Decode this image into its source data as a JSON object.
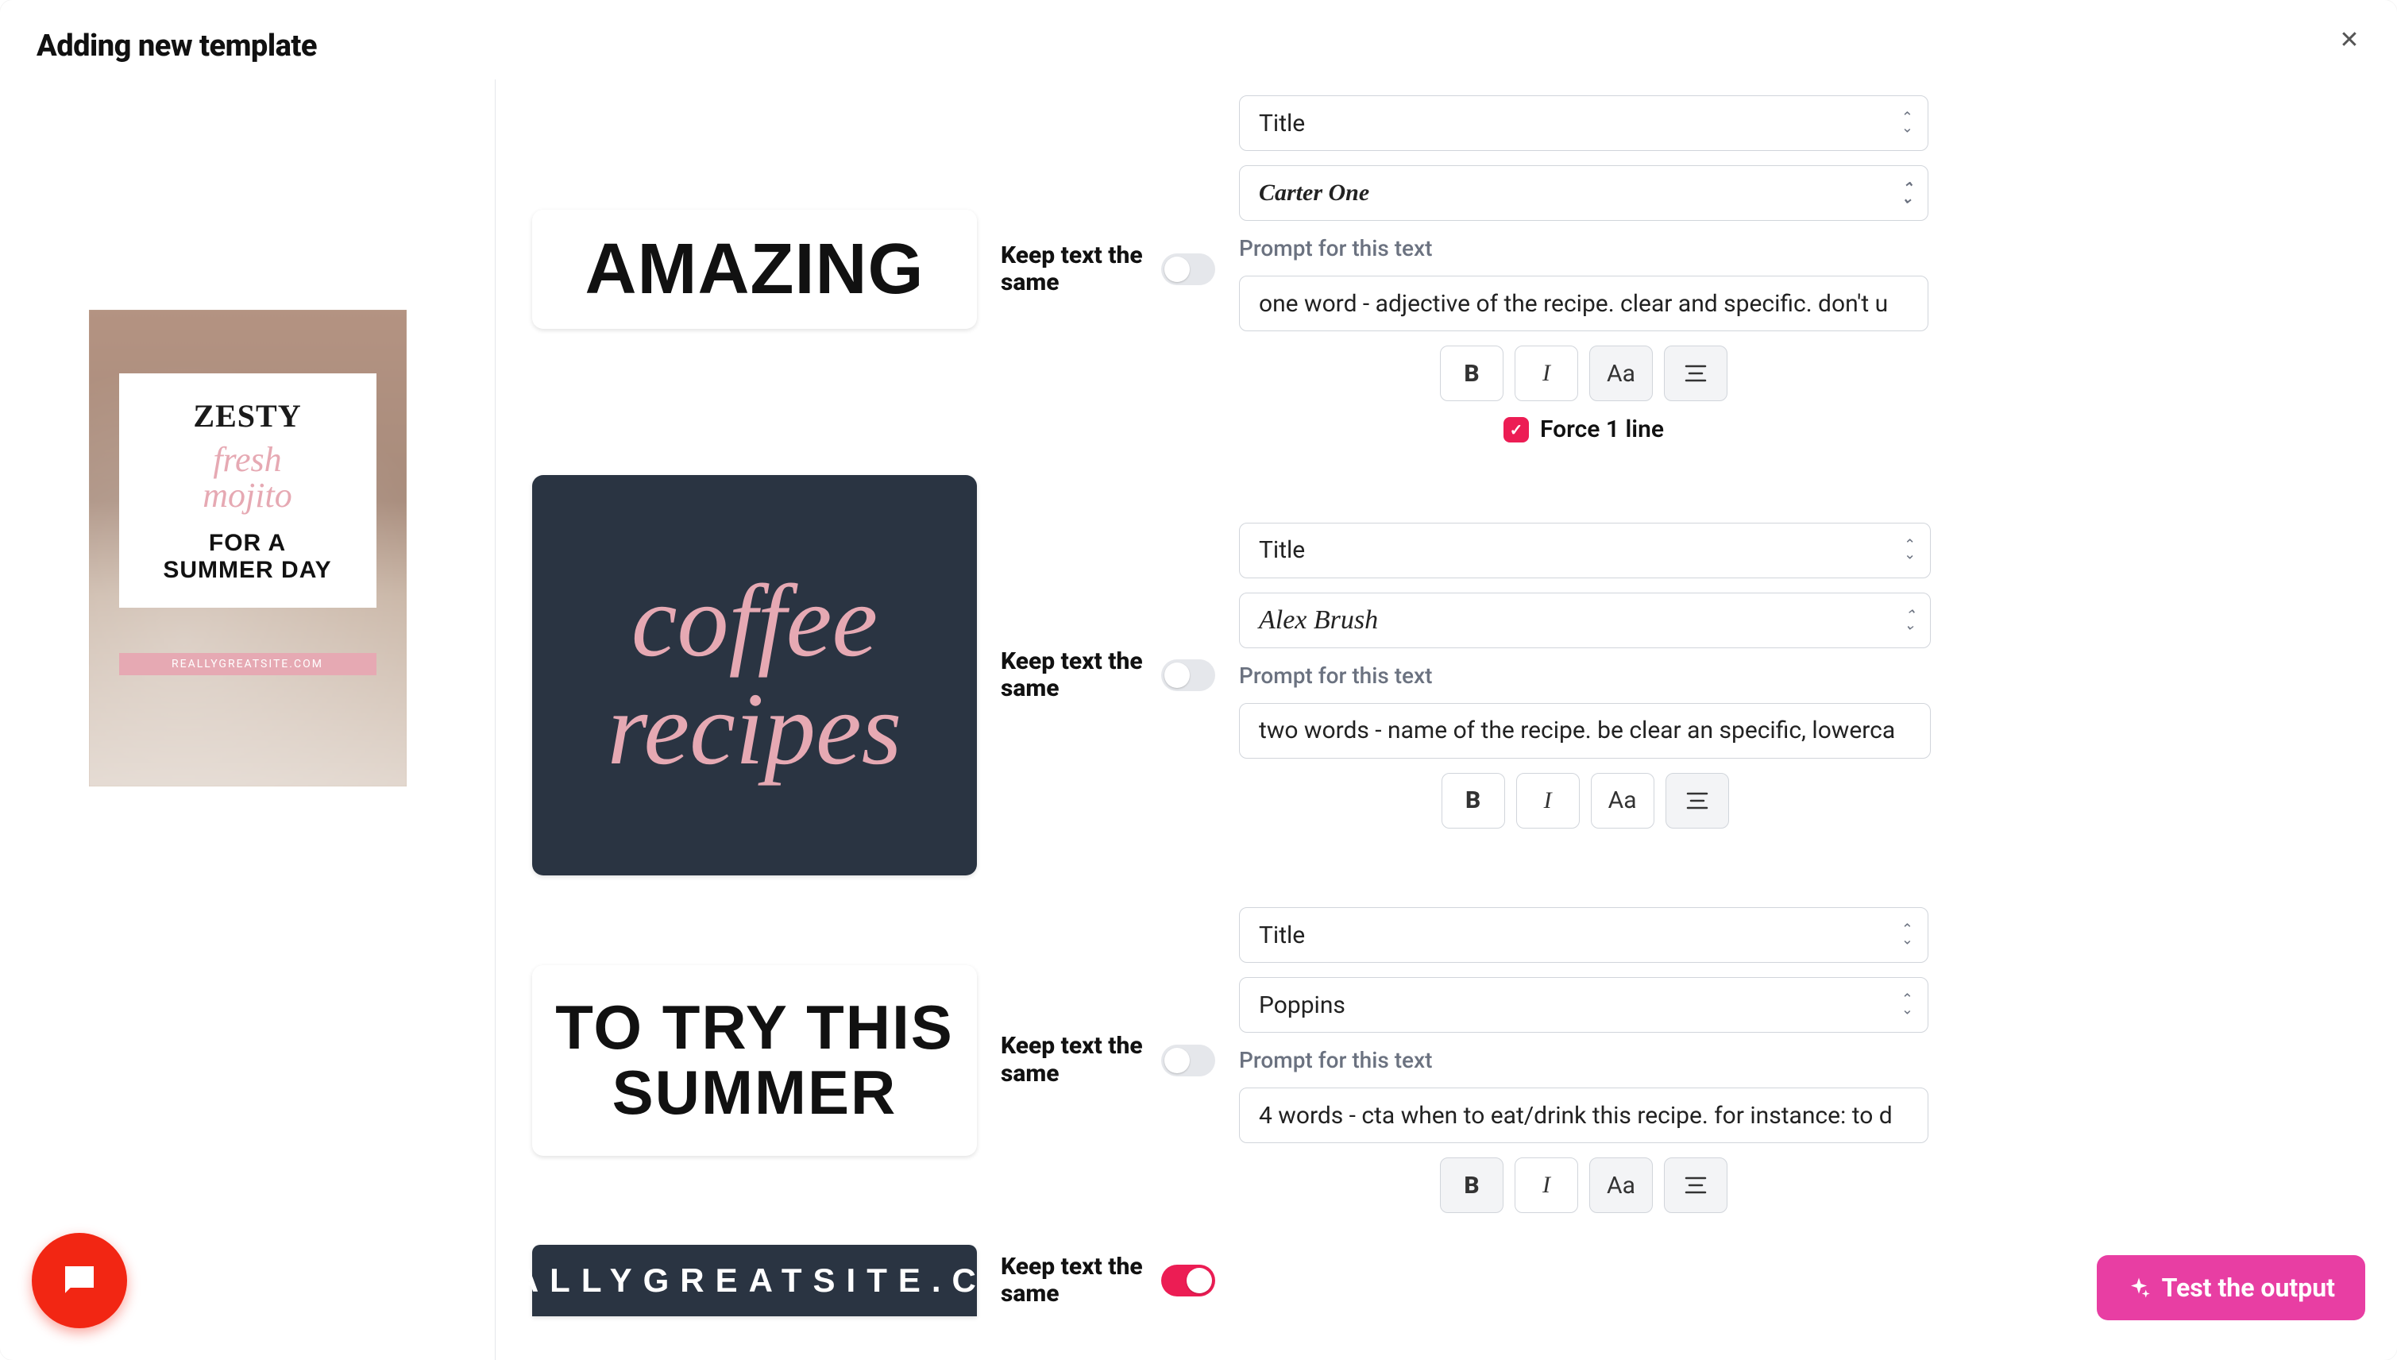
{
  "header": {
    "title": "Adding new template"
  },
  "preview": {
    "line1": "ZESTY",
    "line2": "fresh",
    "line3": "mojito",
    "line4": "FOR A",
    "line5": "SUMMER DAY",
    "linkbar": "REALLYGREATSITE.COM"
  },
  "keep_text_label": "Keep text the same",
  "prompt_label": "Prompt for this text",
  "force_one_line_label": "Force 1 line",
  "rows": [
    {
      "thumb_text": "AMAZING",
      "role": "Title",
      "font": "Carter One",
      "prompt": "one word - adjective of the recipe. clear and specific. don't u",
      "toolbar": {
        "bold": false,
        "italic": false,
        "case": true,
        "align": true
      },
      "force1": true,
      "keep_same": false
    },
    {
      "thumb_text": "coffee recipes",
      "role": "Title",
      "font": "Alex Brush",
      "prompt": "two words - name of the recipe. be clear an specific, lowerca",
      "toolbar": {
        "bold": false,
        "italic": false,
        "case": false,
        "align": true
      },
      "force1": false,
      "keep_same": false
    },
    {
      "thumb_text": "TO TRY THIS SUMMER",
      "role": "Title",
      "font": "Poppins",
      "prompt": "4 words - cta when to eat/drink this recipe. for instance: to d",
      "toolbar": {
        "bold": true,
        "italic": true,
        "case": true,
        "align": true
      },
      "force1": false,
      "keep_same": false
    },
    {
      "thumb_text": "REALLYGREATSITE.COM",
      "keep_same": true
    }
  ],
  "test_button": "Test the output"
}
